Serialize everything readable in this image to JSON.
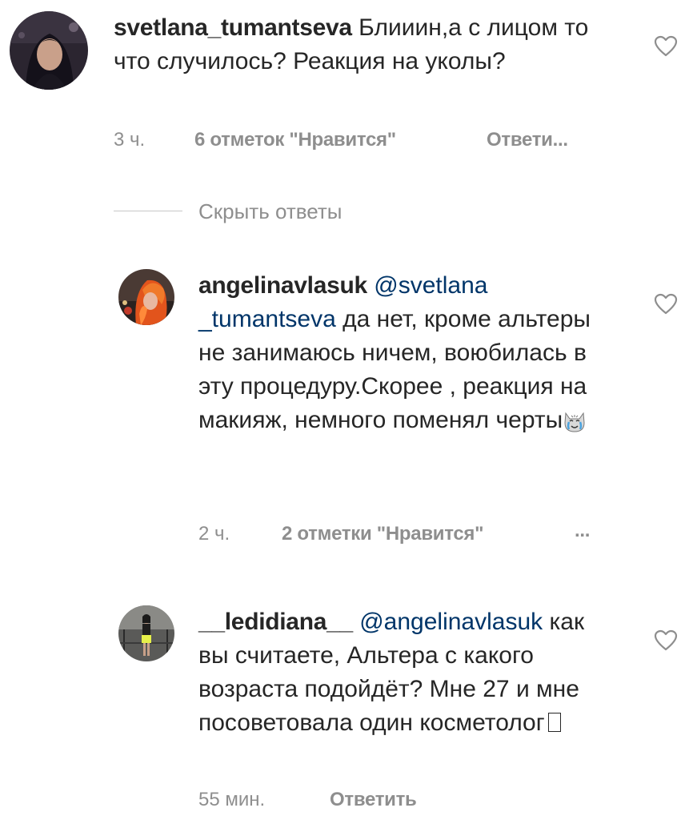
{
  "comments": [
    {
      "username": "svetlana_tumantseva",
      "text": "Блииин,а с лицом то что случилось? Реакция на уколы?",
      "time": "3 ч.",
      "likes": "6 отметок \"Нравится\"",
      "reply": "Ответи..."
    },
    {
      "username": "angelinavlasuk",
      "mention": "@svetlana _tumantseva",
      "text": "да нет, кроме альтеры не занимаюсь ничем, воюбилась в эту процедуру.Скорее , реакция на макияж, немного поменял черты",
      "emoji": "crying-cat-emoji",
      "time": "2 ч.",
      "likes": "2 отметки \"Нравится\"",
      "reply": "..."
    },
    {
      "username": "__ledidiana__",
      "mention": "@angelinavlasuk",
      "text": "как вы считаете, Альтера с какого возраста подойдёт? Мне 27 и мне посоветовала один косметолог",
      "time": "55 мин.",
      "reply": "Ответить"
    }
  ],
  "hide_replies": "Скрыть ответы",
  "colors": {
    "text": "#262626",
    "secondary": "#8e8e8e",
    "mention": "#003569",
    "divider": "#c7c7c7"
  }
}
